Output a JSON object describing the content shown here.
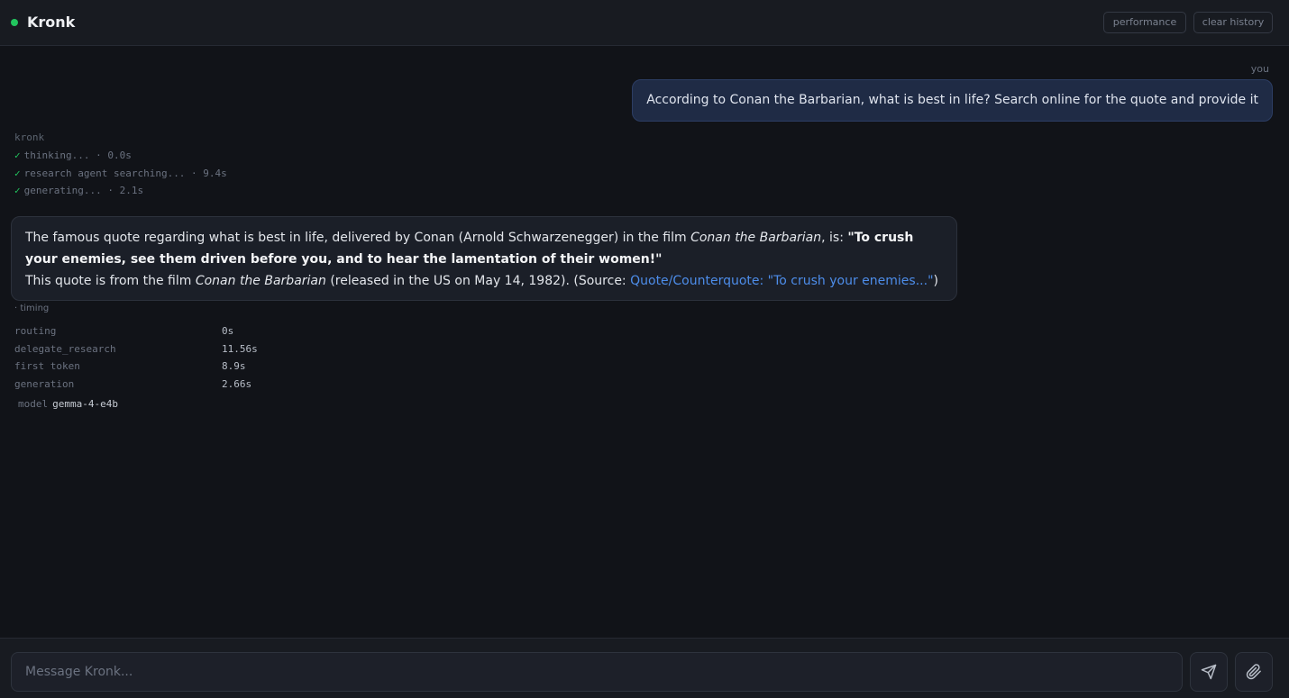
{
  "header": {
    "title": "Kronk",
    "performance_label": "performance",
    "clear_label": "clear history",
    "status_color": "#22c55e"
  },
  "user": {
    "label": "you",
    "message": "According to Conan the Barbarian, what is best in life? Search online for the quote and provide it"
  },
  "assistant": {
    "label": "kronk",
    "steps": [
      {
        "text": "thinking... · 0.0s",
        "done": true
      },
      {
        "text": "research agent searching... · 9.4s",
        "done": true
      },
      {
        "text": "generating... · 2.1s",
        "done": true
      }
    ],
    "response": {
      "p1_a": "The famous quote regarding what is best in life, delivered by Conan (Arnold Schwarzenegger) in the film ",
      "p1_film": "Conan the Barbarian",
      "p1_b": ", is: ",
      "p1_quote": "\"To crush your enemies, see them driven before you, and to hear the lamentation of their women!\"",
      "p2_a": "This quote is from the film ",
      "p2_film": "Conan the Barbarian",
      "p2_b": " (released in the US on May 14, 1982). (Source: ",
      "p2_link": "Quote/Counterquote: \"To crush your enemies...\"",
      "p2_c": ")"
    },
    "timing_label": "· timing",
    "timing": [
      {
        "key": "routing",
        "value": "0s"
      },
      {
        "key": "delegate_research",
        "value": "11.56s"
      },
      {
        "key": "first token",
        "value": "8.9s"
      },
      {
        "key": "generation",
        "value": "2.66s"
      }
    ],
    "model_key": "model",
    "model_value": "gemma-4-e4b"
  },
  "composer": {
    "placeholder": "Message Kronk...",
    "send_icon": "send-icon",
    "attach_icon": "paperclip-icon"
  }
}
